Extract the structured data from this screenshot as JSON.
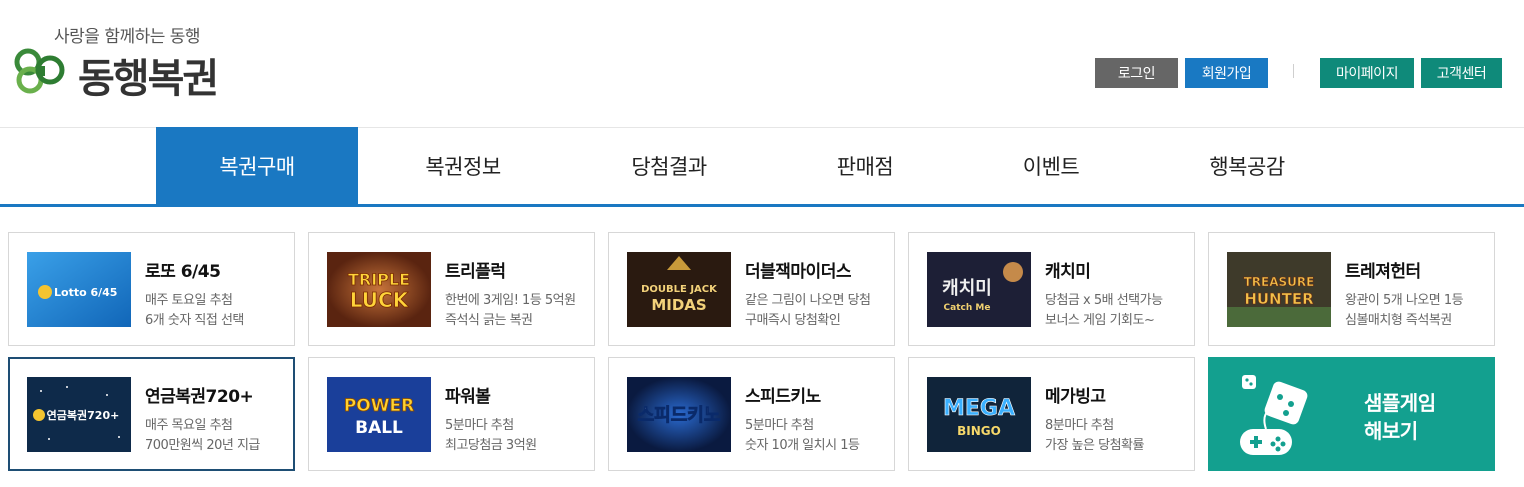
{
  "header": {
    "slogan": "사랑을 함께하는 동행",
    "logo_text": "동행복권",
    "login_label": "로그인",
    "join_label": "회원가입",
    "mypage_label": "마이페이지",
    "cs_label": "고객센터"
  },
  "nav": {
    "items": [
      {
        "label": "복권구매"
      },
      {
        "label": "복권정보"
      },
      {
        "label": "당첨결과"
      },
      {
        "label": "판매점"
      },
      {
        "label": "이벤트"
      },
      {
        "label": "행복공감"
      }
    ],
    "active_index": 0
  },
  "games": [
    {
      "title": "로또 6/45",
      "desc1": "매주 토요일 추첨",
      "desc2": "6개 숫자 직접 선택",
      "logo": "Lotto 6/45"
    },
    {
      "title": "트리플럭",
      "desc1": "한번에 3게임! 1등 5억원",
      "desc2": "즉석식 긁는 복권",
      "logo1": "TRIPLE",
      "logo2": "LUCK"
    },
    {
      "title": "더블잭마이더스",
      "desc1": "같은 그림이 나오면 당첨",
      "desc2": "구매즉시 당첨확인",
      "logo1": "DOUBLE JACK",
      "logo2": "MIDAS"
    },
    {
      "title": "캐치미",
      "desc1": "당첨금 x 5배 선택가능",
      "desc2": "보너스 게임 기회도~",
      "logo1": "캐치미",
      "logo2": "Catch Me"
    },
    {
      "title": "트레져헌터",
      "desc1": "왕관이 5개 나오면 1등",
      "desc2": "심볼매치형 즉석복권",
      "logo1": "TREASURE",
      "logo2": "HUNTER"
    },
    {
      "title": "연금복권720+",
      "desc1": "매주 목요일 추첨",
      "desc2": "700만원씩 20년 지급",
      "logo": "연금복권720+"
    },
    {
      "title": "파워볼",
      "desc1": "5분마다 추첨",
      "desc2": "최고당첨금 3억원",
      "logo1": "POWER",
      "logo2": "BALL"
    },
    {
      "title": "스피드키노",
      "desc1": "5분마다 추첨",
      "desc2": "숫자 10개 일치시 1등",
      "logo": "스피드키노"
    },
    {
      "title": "메가빙고",
      "desc1": "8분마다 추첨",
      "desc2": "가장 높은 당첨확률",
      "logo1": "MEGA",
      "logo2": "BINGO"
    }
  ],
  "sample": {
    "line1": "샘플게임",
    "line2": "해보기",
    "icon": "dice-gamepad-icon"
  },
  "colors": {
    "primary_blue": "#1a78c2",
    "teal": "#0f8a7a",
    "sample_teal": "#13a08f",
    "login_gray": "#666666",
    "selected_border": "#1e4e74"
  }
}
